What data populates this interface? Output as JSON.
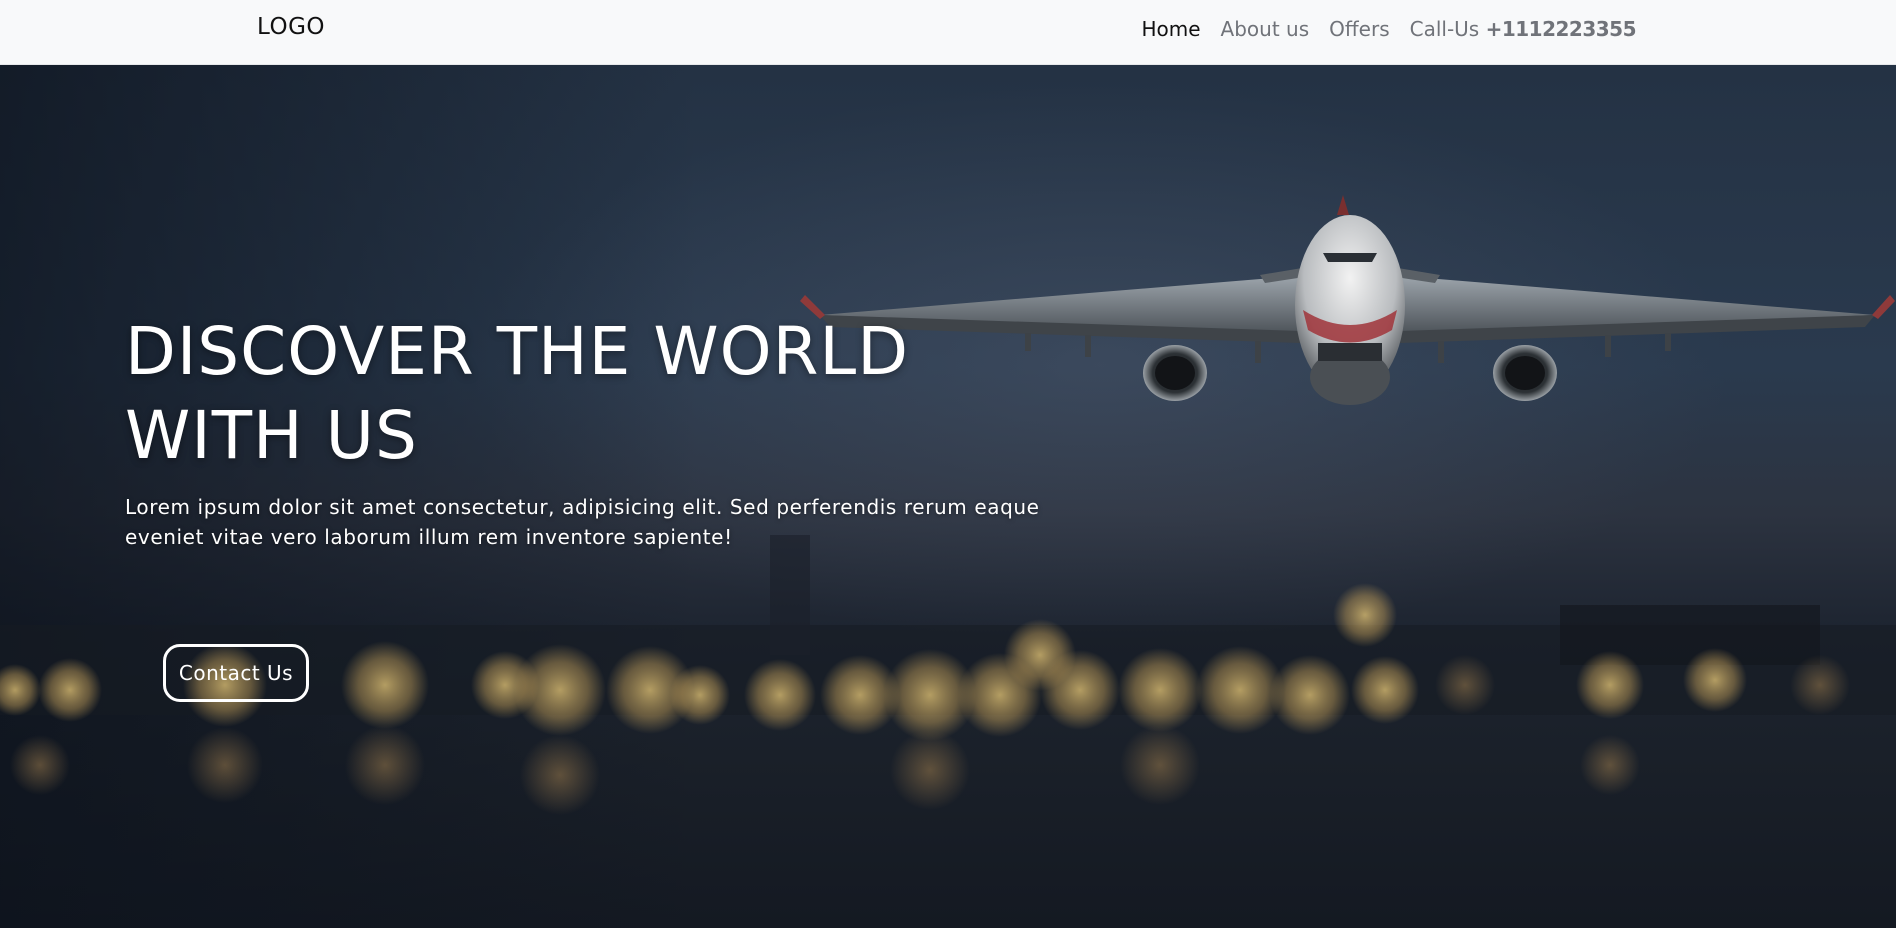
{
  "navbar": {
    "logo": "LOGO",
    "links": [
      "Home",
      "About us",
      "Offers"
    ],
    "call_label": "Call-Us ",
    "call_number": "+1112223355",
    "active_link": "Home"
  },
  "hero": {
    "title_line1": "DISCOVER THE WORLD",
    "title_line2": "WITH US",
    "description": "Lorem ipsum dolor sit amet consectetur, adipisicing elit. Sed perferendis rerum eaque eveniet vitae vero laborum illum rem inventore sapiente!",
    "button_label": "Contact Us",
    "background_image": "airplane-over-city-lights-photo"
  },
  "colors": {
    "navbar_bg": "#f8f9fa",
    "nav_active": "#111111",
    "nav_inactive": "#707379",
    "hero_text": "#ffffff"
  }
}
